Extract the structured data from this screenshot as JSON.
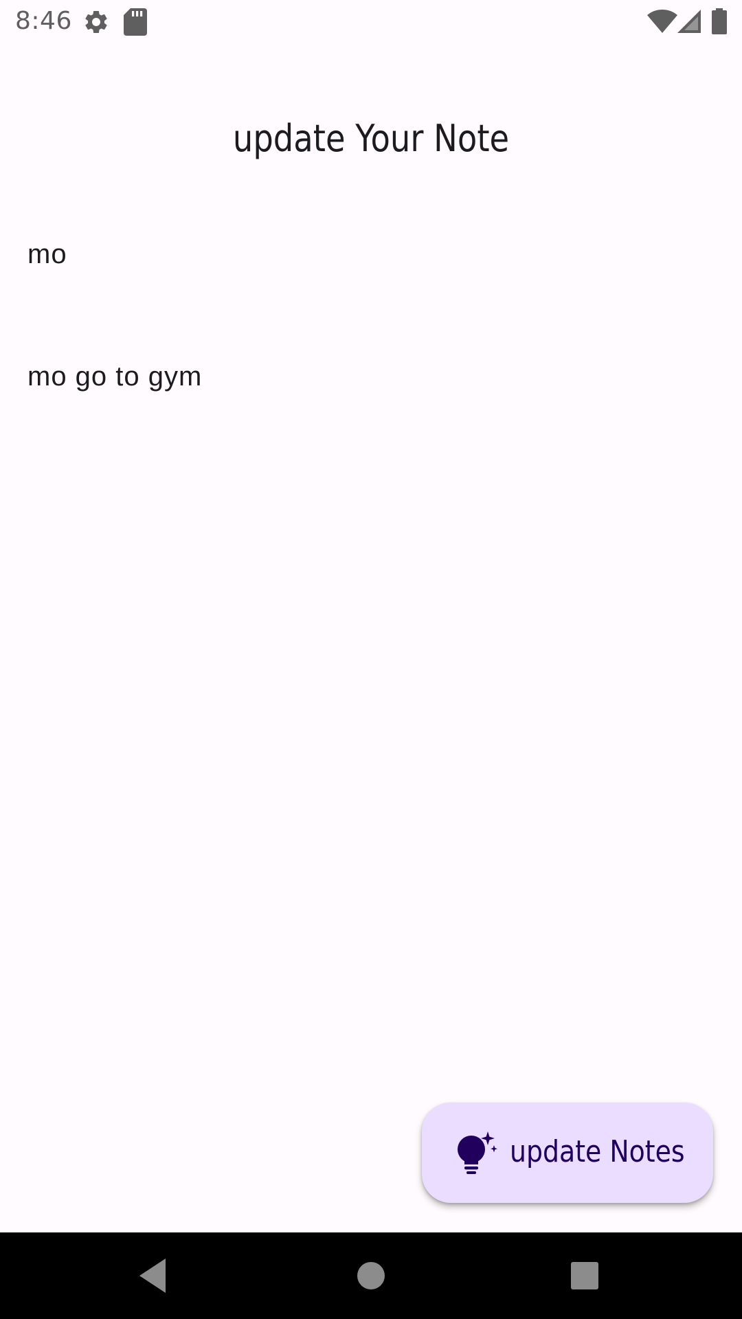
{
  "status_bar": {
    "time": "8:46",
    "icons": [
      "settings-icon",
      "sd-card-icon",
      "wifi-icon",
      "cellular-icon",
      "battery-icon"
    ]
  },
  "header": {
    "title": "update Your Note"
  },
  "note": {
    "title_value": "mo",
    "body_value": "mo go to gym"
  },
  "fab": {
    "icon": "lightbulb-sparkle-icon",
    "label": "update Notes"
  },
  "nav_bar": {
    "buttons": [
      "back-icon",
      "home-icon",
      "recents-icon"
    ]
  },
  "colors": {
    "background": "#fffbfe",
    "fab_background": "#eaddff",
    "fab_foreground": "#21005d",
    "text": "#1c1b1f",
    "nav_background": "#000000"
  }
}
